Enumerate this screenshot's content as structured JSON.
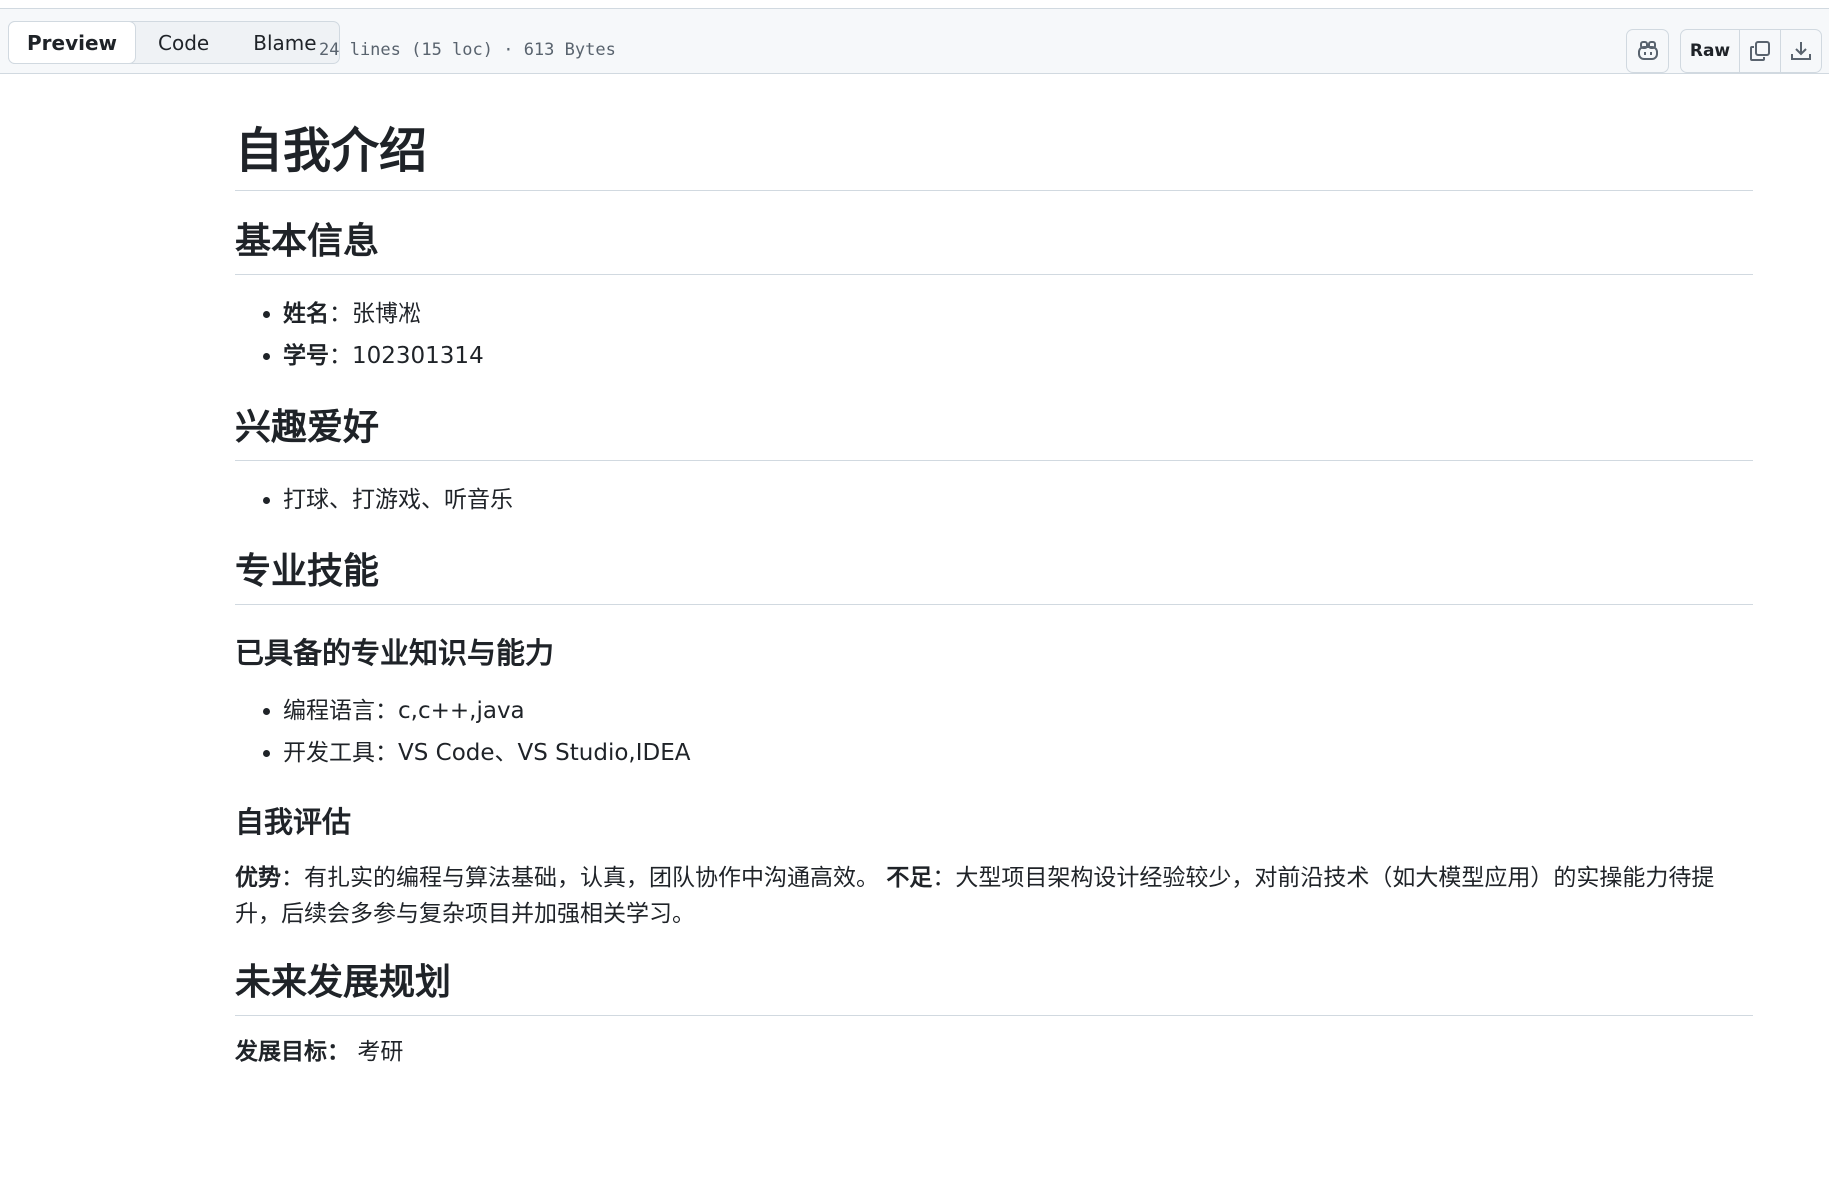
{
  "toolbar": {
    "tabs": [
      {
        "label": "Preview",
        "active": true
      },
      {
        "label": "Code",
        "active": false
      },
      {
        "label": "Blame",
        "active": false
      }
    ],
    "file_meta": "24 lines (15 loc) · 613 Bytes",
    "raw_label": "Raw",
    "icons": [
      "copilot-icon",
      "copy-icon",
      "download-icon"
    ]
  },
  "doc": {
    "title": "自我介绍",
    "basic": {
      "heading": "基本信息",
      "name_label": "姓名",
      "name_value": "：张博凇",
      "id_label": "学号",
      "id_value": "：102301314"
    },
    "hobby": {
      "heading": "兴趣爱好",
      "item": "打球、打游戏、听音乐"
    },
    "skills": {
      "heading": "专业技能",
      "sub1": "已具备的专业知识与能力",
      "lang": "编程语言：c,c++,java",
      "tools": "开发工具：VS Code、VS Studio,IDEA",
      "sub2": "自我评估",
      "adv_label": "优势",
      "adv_text": "：有扎实的编程与算法基础，认真，团队协作中沟通高效。",
      "dis_label": "不足",
      "dis_text": "：大型项目架构设计经验较少，对前沿技术（如大模型应用）的实操能力待提升，后续会多参与复杂项目并加强相关学习。"
    },
    "future": {
      "heading": "未来发展规划",
      "goal_label": "发展目标：",
      "goal_value": "考研"
    }
  }
}
